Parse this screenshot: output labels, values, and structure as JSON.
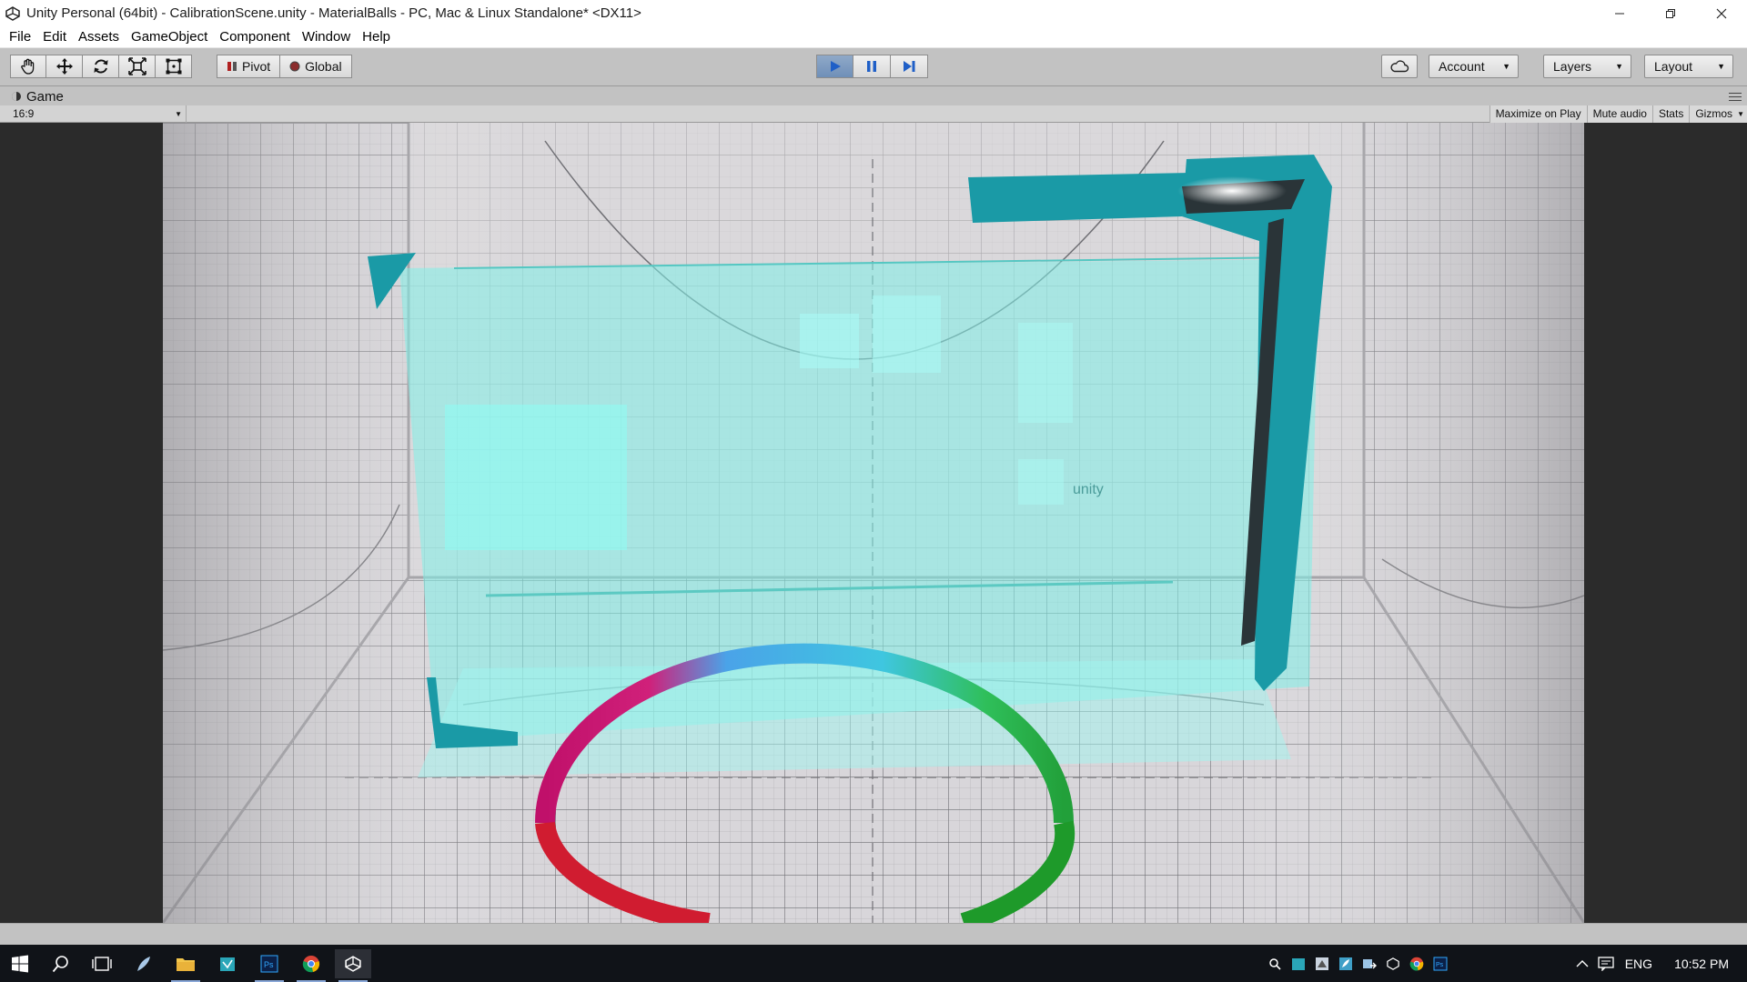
{
  "window": {
    "title": "Unity Personal (64bit) - CalibrationScene.unity - MaterialBalls - PC, Mac & Linux Standalone* <DX11>",
    "controls": [
      "minimize",
      "restore",
      "close"
    ]
  },
  "menu": {
    "items": [
      "File",
      "Edit",
      "Assets",
      "GameObject",
      "Component",
      "Window",
      "Help"
    ]
  },
  "toolbar": {
    "transform_tools": [
      "hand-tool",
      "move-tool",
      "rotate-tool",
      "scale-tool",
      "rect-tool"
    ],
    "pivot_label": "Pivot",
    "global_label": "Global",
    "play_active": true,
    "account_label": "Account",
    "layers_label": "Layers",
    "layout_label": "Layout"
  },
  "game_tab": {
    "label": "Game",
    "aspect": "16:9",
    "buttons": {
      "maximize": "Maximize on Play",
      "mute": "Mute audio",
      "stats": "Stats",
      "gizmos": "Gizmos"
    }
  },
  "scene": {
    "watermark": "unity",
    "colors": {
      "hologram": "#7ff0e8",
      "frame": "#1a9aa6",
      "floor": "#d7d4d9"
    }
  },
  "taskbar": {
    "apps": [
      "windows-start",
      "search",
      "task-view",
      "feather-app",
      "file-explorer",
      "store-app",
      "photoshop",
      "chrome",
      "unity"
    ],
    "tray": {
      "language": "ENG",
      "time": "10:52 PM"
    }
  }
}
